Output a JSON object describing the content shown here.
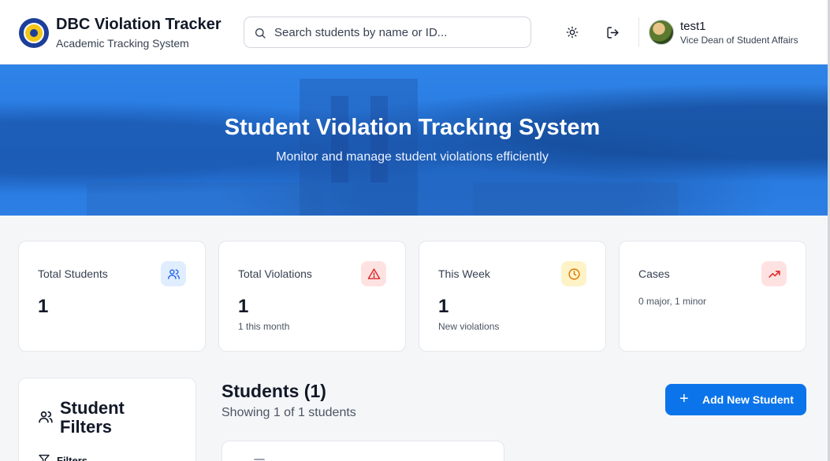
{
  "header": {
    "app_title": "DBC Violation Tracker",
    "app_subtitle": "Academic Tracking System",
    "search_placeholder": "Search students by name or ID...",
    "user_name": "test1",
    "user_role": "Vice Dean of Student Affairs",
    "icons": [
      "logo",
      "search-icon",
      "sun-icon",
      "logout-icon",
      "avatar"
    ]
  },
  "hero": {
    "title": "Student Violation Tracking System",
    "subtitle": "Monitor and manage student violations efficiently"
  },
  "stats": [
    {
      "label": "Total Students",
      "value": "1",
      "note": "",
      "icon": "users-icon",
      "color": "#2563eb",
      "bg": "#e0edff"
    },
    {
      "label": "Total Violations",
      "value": "1",
      "note": "1 this month",
      "icon": "alert-triangle-icon",
      "color": "#dc2626",
      "bg": "#fee2e2"
    },
    {
      "label": "This Week",
      "value": "1",
      "note": "New violations",
      "icon": "clock-icon",
      "color": "#d97706",
      "bg": "#fef3c7"
    },
    {
      "label": "Cases",
      "value": "",
      "note": "0 major, 1 minor",
      "icon": "trending-up-icon",
      "color": "#dc2626",
      "bg": "#fee2e2"
    }
  ],
  "filters": {
    "title": "Student Filters",
    "sub_label": "Filters"
  },
  "students": {
    "title": "Students (1)",
    "subtitle": "Showing 1 of 1 students",
    "add_button": "Add New Student"
  },
  "colors": {
    "primary": "#0b74ea",
    "hero": "#2a7de3"
  }
}
